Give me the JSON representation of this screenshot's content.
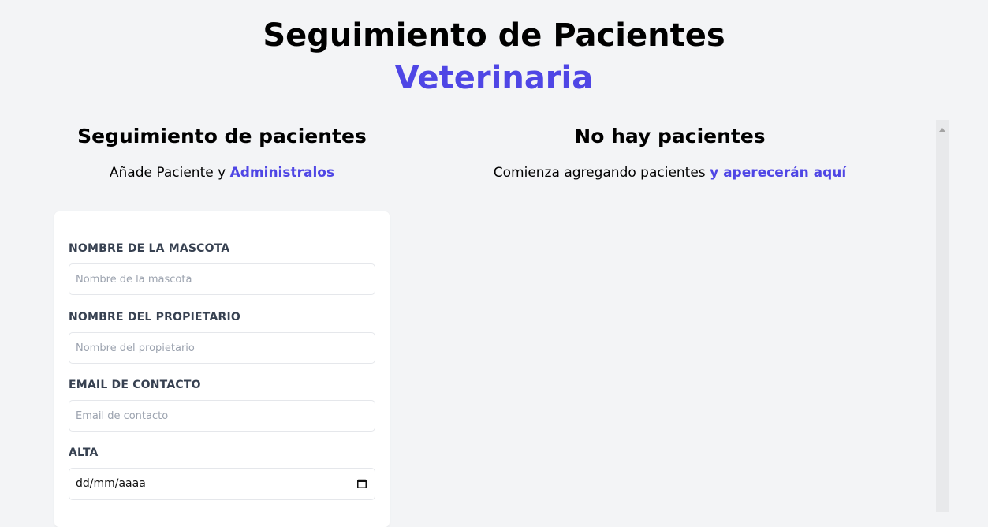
{
  "header": {
    "title": "Seguimiento de Pacientes",
    "subtitle": "Veterinaria",
    "accent_color": "#4f46e5"
  },
  "form_section": {
    "title": "Seguimiento de pacientes",
    "subtitle_prefix": "Añade Paciente y ",
    "subtitle_accent": "Administralos"
  },
  "form": {
    "pet_name": {
      "label": "NOMBRE DE LA MASCOTA",
      "placeholder": "Nombre de la mascota",
      "value": ""
    },
    "owner_name": {
      "label": "NOMBRE DEL PROPIETARIO",
      "placeholder": "Nombre del propietario",
      "value": ""
    },
    "email": {
      "label": "EMAIL DE CONTACTO",
      "placeholder": "Email de contacto",
      "value": ""
    },
    "discharge": {
      "label": "ALTA",
      "placeholder": "dd/mm/aaaa",
      "icon": "calendar-icon"
    }
  },
  "patients_section": {
    "title": "No hay pacientes",
    "subtitle_prefix": "Comienza agregando pacientes ",
    "subtitle_accent": "y aperecerán aquí"
  }
}
